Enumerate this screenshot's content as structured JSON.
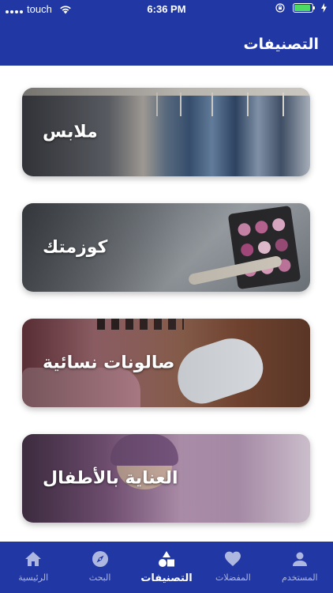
{
  "status_bar": {
    "carrier": "touch",
    "time": "6:36 PM"
  },
  "header": {
    "title": "التصنيفات"
  },
  "categories": [
    {
      "label": "ملابس"
    },
    {
      "label": "كوزمتك"
    },
    {
      "label": "صالونات نسائية"
    },
    {
      "label": "العناية بالأطفال"
    }
  ],
  "tabbar": {
    "items": [
      {
        "label": "الرئيسية",
        "icon": "home-icon"
      },
      {
        "label": "البحث",
        "icon": "compass-icon"
      },
      {
        "label": "التصنيفات",
        "icon": "shapes-icon",
        "active": true
      },
      {
        "label": "المفضلات",
        "icon": "heart-icon"
      },
      {
        "label": "المستخدم",
        "icon": "user-icon"
      }
    ]
  },
  "colors": {
    "brand": "#2137a3",
    "tab_inactive": "#aeb7df",
    "battery": "#4cd964"
  }
}
